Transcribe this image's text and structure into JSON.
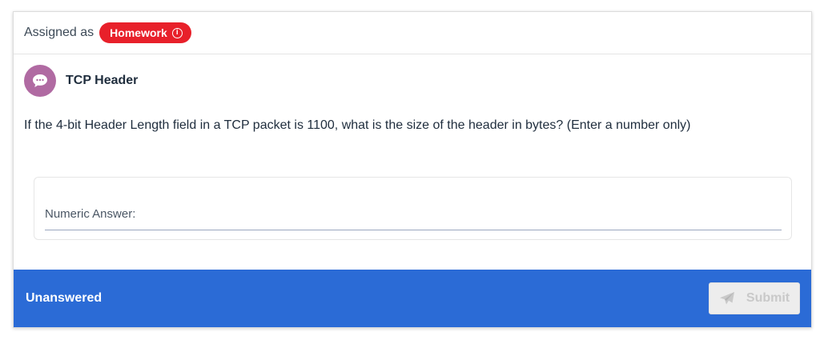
{
  "assignment": {
    "label": "Assigned as",
    "badge": "Homework",
    "badge_color": "#e8202a",
    "info_icon": "info-icon"
  },
  "question": {
    "avatar_icon": "chat-bubble-icon",
    "avatar_color": "#b06aa2",
    "title": "TCP Header",
    "text": "If the 4-bit Header Length field in a TCP packet is 1100, what is the size of the header in bytes? (Enter a number only)"
  },
  "answer": {
    "placeholder": "Numeric Answer:",
    "value": ""
  },
  "footer": {
    "status": "Unanswered",
    "submit_label": "Submit",
    "submit_icon": "paper-plane-icon",
    "bar_color": "#2b6bd6"
  }
}
